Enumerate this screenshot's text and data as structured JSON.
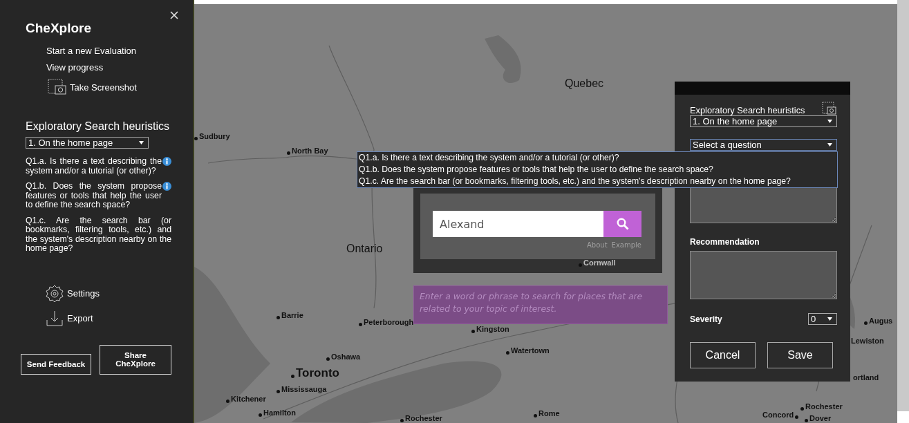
{
  "sidebar": {
    "title": "CheXplore",
    "menu": [
      {
        "label": "Start a new Evaluation",
        "kind": "plain"
      },
      {
        "label": "View progress",
        "kind": "plain"
      },
      {
        "label": "Take Screenshot",
        "kind": "screenshot"
      }
    ],
    "heuristics_title": "Exploratory Search heuristics",
    "phase_select": "1. On the home page",
    "questions": [
      {
        "text": "Q1.a. Is there a text describing the system and/or a tutorial (or other)?",
        "info": true
      },
      {
        "text": "Q1.b. Does the system propose features or tools that help the user to define the search space?",
        "info": true
      },
      {
        "text": "Q1.c. Are the search bar (or bookmarks, filtering tools, etc.) and the system's description nearby on the home page?",
        "info": false
      }
    ],
    "tools": [
      {
        "label": "Settings",
        "kind": "settings"
      },
      {
        "label": "Export",
        "kind": "export"
      }
    ],
    "buttons": [
      "Send Feedback",
      "Share CheXplore"
    ]
  },
  "map": {
    "labels": [
      {
        "text": "Quebec",
        "kind": "region"
      },
      {
        "text": "Sudbury",
        "kind": "city"
      },
      {
        "text": "North Bay",
        "kind": "city"
      },
      {
        "text": "Ontario",
        "kind": "region"
      },
      {
        "text": "Cornwall",
        "kind": "city"
      },
      {
        "text": "Barrie",
        "kind": "city"
      },
      {
        "text": "Peterborough",
        "kind": "city"
      },
      {
        "text": "Kingston",
        "kind": "city"
      },
      {
        "text": "Watertown",
        "kind": "city"
      },
      {
        "text": "Oshawa",
        "kind": "city"
      },
      {
        "text": "Toronto",
        "kind": "capital"
      },
      {
        "text": "Mississauga",
        "kind": "city"
      },
      {
        "text": "Kitchener",
        "kind": "city"
      },
      {
        "text": "Hamilton",
        "kind": "city"
      },
      {
        "text": "Rochester",
        "kind": "city"
      },
      {
        "text": "Rome",
        "kind": "city"
      },
      {
        "text": "Augus",
        "kind": "city"
      },
      {
        "text": "Lewiston",
        "kind": "plain"
      },
      {
        "text": "ortland",
        "kind": "plain"
      },
      {
        "text": "Rochester",
        "kind": "city"
      },
      {
        "text": "Concord",
        "kind": "city_after"
      },
      {
        "text": "Dover",
        "kind": "city"
      }
    ]
  },
  "search_widget": {
    "value": "Alexand",
    "links": [
      "About",
      "Example"
    ],
    "hint": "Enter a word or phrase to search for places that are related to your topic of interest."
  },
  "panel": {
    "title": "Exploratory Search heuristics",
    "phase_select": "1. On the home page",
    "question_select": {
      "value": "Select a question",
      "expanded": true,
      "options": [
        "Q1.a. Is there a text describing the system and/or a tutorial (or other)?",
        "Q1.b. Does the system propose features or tools that help the user to define the search space?",
        "Q1.c. Are the search bar (or bookmarks, filtering tools, etc.) and the system's description nearby on the home page?"
      ]
    },
    "recommendation_label": "Recommendation",
    "severity_label": "Severity",
    "severity_value": "0",
    "buttons": [
      "Cancel",
      "Save"
    ]
  }
}
